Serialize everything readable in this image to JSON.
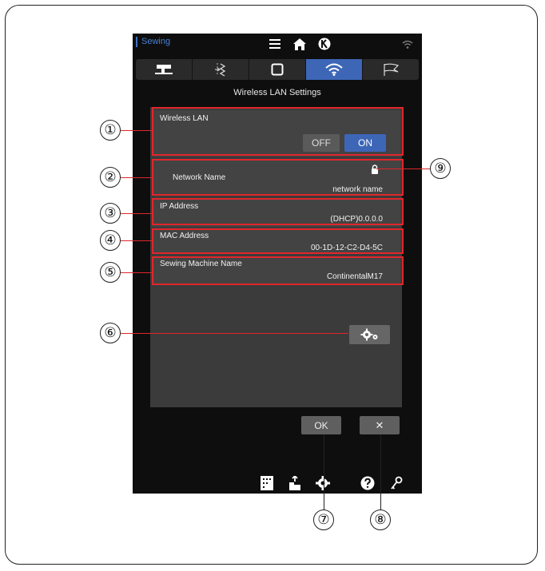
{
  "status_bar": {
    "app_label": "Sewing"
  },
  "screen": {
    "title": "Wireless LAN Settings"
  },
  "wireless_lan": {
    "label": "Wireless LAN",
    "off_label": "OFF",
    "on_label": "ON",
    "state": "ON"
  },
  "network": {
    "label": "Network Name",
    "value": "network name"
  },
  "ip": {
    "label": "IP Address",
    "value": "(DHCP)0.0.0.0"
  },
  "mac": {
    "label": "MAC Address",
    "value": "00-1D-12-C2-D4-5C"
  },
  "machine": {
    "label": "Sewing Machine Name",
    "value": "ContinentalM17"
  },
  "dialog": {
    "ok_label": "OK",
    "cancel_label": "✕"
  },
  "callouts": [
    "①",
    "②",
    "③",
    "④",
    "⑤",
    "⑥",
    "⑦",
    "⑧",
    "⑨"
  ],
  "colors": {
    "accent": "#3d66b7",
    "callout": "#e0262b",
    "panel": "#3b3b3b",
    "screen_bg": "#0e0e0e"
  }
}
